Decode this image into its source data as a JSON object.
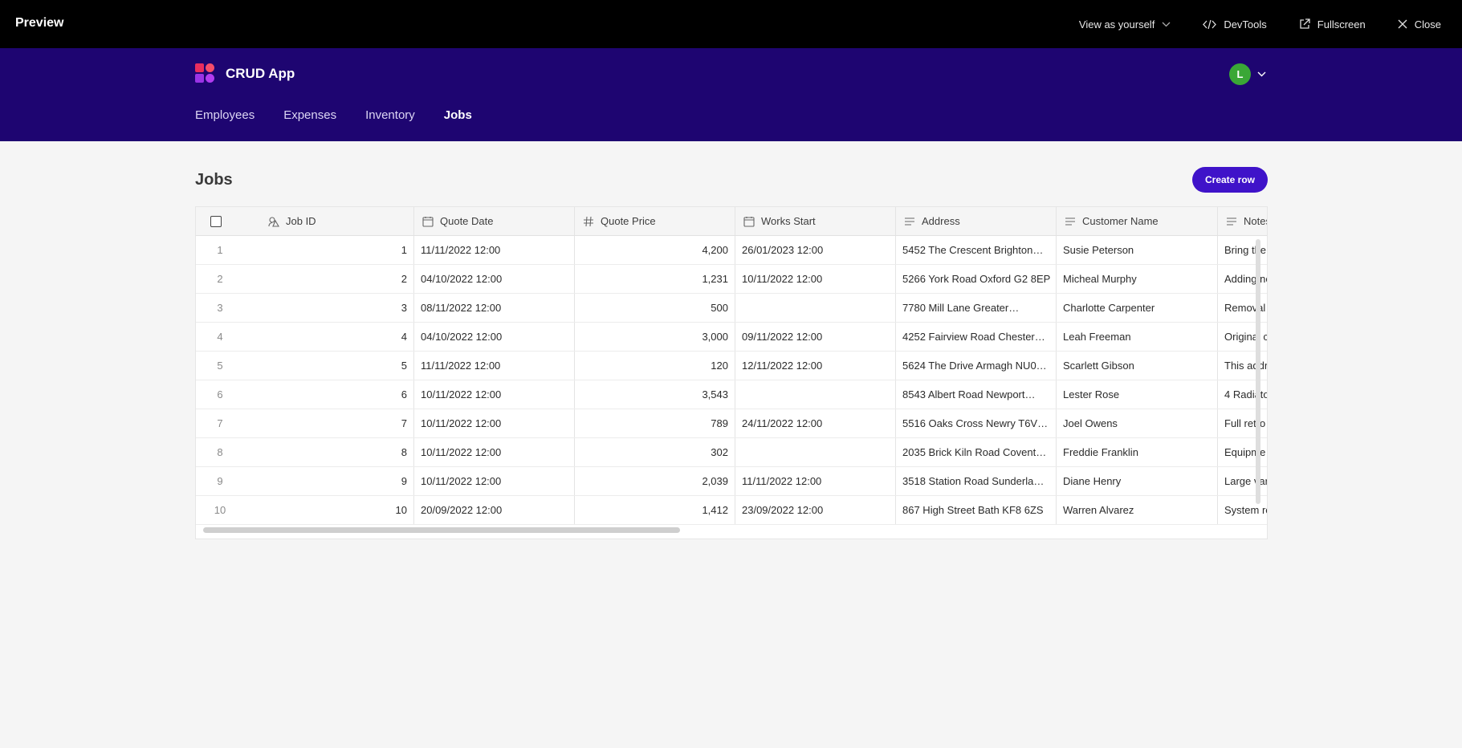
{
  "preview_bar": {
    "title": "Preview",
    "view_as": "View as yourself",
    "devtools": "DevTools",
    "fullscreen": "Fullscreen",
    "close": "Close"
  },
  "app": {
    "title": "CRUD App",
    "user_initial": "L",
    "avatar_color": "#3aa736",
    "header_color": "#1e0571"
  },
  "nav": {
    "items": [
      "Employees",
      "Expenses",
      "Inventory",
      "Jobs"
    ],
    "active": "Jobs"
  },
  "page": {
    "title": "Jobs",
    "create_button": "Create row"
  },
  "table": {
    "columns": [
      "Job ID",
      "Quote Date",
      "Quote Price",
      "Works Start",
      "Address",
      "Customer Name",
      "Notes"
    ],
    "rows": [
      {
        "n": "1",
        "id": "1",
        "quote_date": "11/11/2022 12:00",
        "price": "4,200",
        "works_start": "26/01/2023 12:00",
        "address": "5452 The Crescent Brighton…",
        "customer": "Susie Peterson",
        "notes": "Bring the"
      },
      {
        "n": "2",
        "id": "2",
        "quote_date": "04/10/2022 12:00",
        "price": "1,231",
        "works_start": "10/11/2022 12:00",
        "address": "5266 York Road Oxford G2 8EP",
        "customer": "Micheal Murphy",
        "notes": "Adding ne"
      },
      {
        "n": "3",
        "id": "3",
        "quote_date": "08/11/2022 12:00",
        "price": "500",
        "works_start": "",
        "address": "7780 Mill Lane Greater…",
        "customer": "Charlotte Carpenter",
        "notes": "Removal"
      },
      {
        "n": "4",
        "id": "4",
        "quote_date": "04/10/2022 12:00",
        "price": "3,000",
        "works_start": "09/11/2022 12:00",
        "address": "4252 Fairview Road Chester…",
        "customer": "Leah Freeman",
        "notes": "Original c"
      },
      {
        "n": "5",
        "id": "5",
        "quote_date": "11/11/2022 12:00",
        "price": "120",
        "works_start": "12/11/2022 12:00",
        "address": "5624 The Drive Armagh NU0…",
        "customer": "Scarlett Gibson",
        "notes": "This addr"
      },
      {
        "n": "6",
        "id": "6",
        "quote_date": "10/11/2022 12:00",
        "price": "3,543",
        "works_start": "",
        "address": "8543 Albert Road Newport…",
        "customer": "Lester Rose",
        "notes": "4 Radiato"
      },
      {
        "n": "7",
        "id": "7",
        "quote_date": "10/11/2022 12:00",
        "price": "789",
        "works_start": "24/11/2022 12:00",
        "address": "5516 Oaks Cross Newry T6V…",
        "customer": "Joel Owens",
        "notes": "Full retro"
      },
      {
        "n": "8",
        "id": "8",
        "quote_date": "10/11/2022 12:00",
        "price": "302",
        "works_start": "",
        "address": "2035 Brick Kiln Road Covent…",
        "customer": "Freddie Franklin",
        "notes": "Equipme"
      },
      {
        "n": "9",
        "id": "9",
        "quote_date": "10/11/2022 12:00",
        "price": "2,039",
        "works_start": "11/11/2022 12:00",
        "address": "3518 Station Road Sunderla…",
        "customer": "Diane Henry",
        "notes": "Large var"
      },
      {
        "n": "10",
        "id": "10",
        "quote_date": "20/09/2022 12:00",
        "price": "1,412",
        "works_start": "23/09/2022 12:00",
        "address": "867 High Street Bath KF8 6ZS",
        "customer": "Warren Alvarez",
        "notes": "System re"
      }
    ]
  }
}
